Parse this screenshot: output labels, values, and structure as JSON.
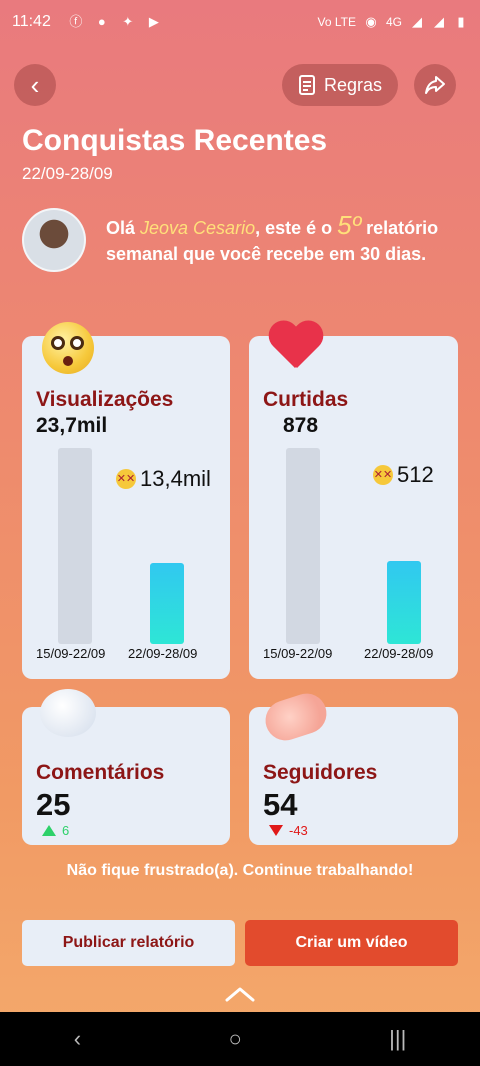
{
  "status": {
    "time": "11:42",
    "network": "Vo LTE",
    "signal_label": "4G"
  },
  "header": {
    "rules_label": "Regras",
    "title": "Conquistas Recentes",
    "date_range": "22/09-28/09"
  },
  "intro": {
    "greeting": "Olá ",
    "name": "Jeova Cesario",
    "mid": ", este é o ",
    "number": "5º",
    "rest": " relatório semanal que você recebe em 30 dias."
  },
  "views": {
    "title": "Visualizações",
    "prev_value": "23,7mil",
    "curr_value": "13,4mil",
    "prev_label": "15/09-22/09",
    "curr_label": "22/09-28/09",
    "prev_raw": 23700,
    "curr_raw": 13400
  },
  "likes": {
    "title": "Curtidas",
    "prev_value": "878",
    "curr_value": "512",
    "prev_label": "15/09-22/09",
    "curr_label": "22/09-28/09",
    "prev_raw": 878,
    "curr_raw": 512
  },
  "comments": {
    "title": "Comentários",
    "value": "25",
    "delta": "6",
    "delta_dir": "up"
  },
  "followers": {
    "title": "Seguidores",
    "value": "54",
    "delta": "-43",
    "delta_dir": "down"
  },
  "footer": {
    "encourage": "Não fique frustrado(a). Continue trabalhando!",
    "publish_label": "Publicar relatório",
    "create_label": "Criar um vídeo"
  },
  "colors": {
    "accent": "#e24b2d",
    "title_red": "#8d1616",
    "up": "#2dd16a",
    "down": "#e01919",
    "bar_current": "#31c8f0"
  },
  "icons": [
    "back-icon",
    "rules-icon",
    "share-icon",
    "shocked-face-icon",
    "heart-icon",
    "speech-bubble-icon",
    "handshake-icon",
    "dizzy-face-icon",
    "chevron-up-icon"
  ]
}
